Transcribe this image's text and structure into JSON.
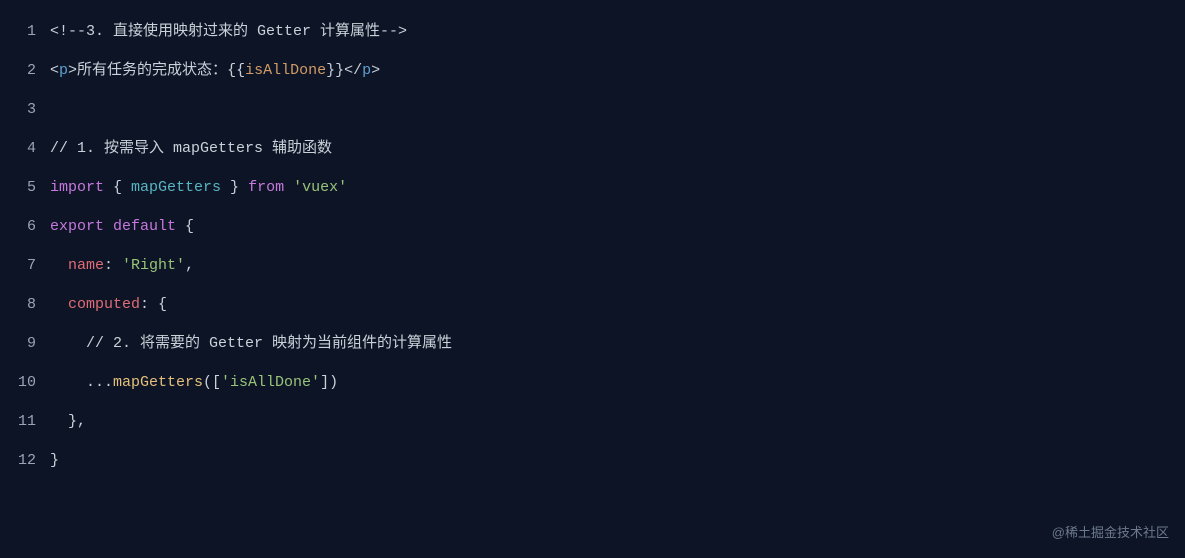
{
  "watermark": "@稀土掘金技术社区",
  "lines": [
    {
      "num": "1",
      "tokens": [
        {
          "cls": "token-comment",
          "text": "<!--3. 直接使用映射过来的 Getter 计算属性-->"
        }
      ]
    },
    {
      "num": "2",
      "tokens": [
        {
          "cls": "token-tag-bracket",
          "text": "<"
        },
        {
          "cls": "token-tag-name",
          "text": "p"
        },
        {
          "cls": "token-tag-bracket",
          "text": ">"
        },
        {
          "cls": "token-text",
          "text": "所有任务的完成状态："
        },
        {
          "cls": "token-text",
          "text": "{{"
        },
        {
          "cls": "token-variable",
          "text": "isAllDone"
        },
        {
          "cls": "token-text",
          "text": "}}"
        },
        {
          "cls": "token-tag-bracket",
          "text": "</"
        },
        {
          "cls": "token-tag-name",
          "text": "p"
        },
        {
          "cls": "token-tag-bracket",
          "text": ">"
        }
      ]
    },
    {
      "num": "3",
      "tokens": []
    },
    {
      "num": "4",
      "tokens": [
        {
          "cls": "token-comment",
          "text": "// 1. 按需导入 mapGetters 辅助函数"
        }
      ]
    },
    {
      "num": "5",
      "tokens": [
        {
          "cls": "token-keyword",
          "text": "import"
        },
        {
          "cls": "token-punctuation",
          "text": " { "
        },
        {
          "cls": "token-identifier",
          "text": "mapGetters"
        },
        {
          "cls": "token-punctuation",
          "text": " } "
        },
        {
          "cls": "token-keyword",
          "text": "from"
        },
        {
          "cls": "token-punctuation",
          "text": " "
        },
        {
          "cls": "token-string",
          "text": "'vuex'"
        }
      ]
    },
    {
      "num": "6",
      "tokens": [
        {
          "cls": "token-keyword",
          "text": "export"
        },
        {
          "cls": "token-punctuation",
          "text": " "
        },
        {
          "cls": "token-keyword",
          "text": "default"
        },
        {
          "cls": "token-punctuation",
          "text": " {"
        }
      ]
    },
    {
      "num": "7",
      "tokens": [
        {
          "cls": "token-punctuation",
          "text": "  "
        },
        {
          "cls": "token-property",
          "text": "name"
        },
        {
          "cls": "token-punctuation",
          "text": ": "
        },
        {
          "cls": "token-string",
          "text": "'Right'"
        },
        {
          "cls": "token-punctuation",
          "text": ","
        }
      ]
    },
    {
      "num": "8",
      "tokens": [
        {
          "cls": "token-punctuation",
          "text": "  "
        },
        {
          "cls": "token-property",
          "text": "computed"
        },
        {
          "cls": "token-punctuation",
          "text": ": {"
        }
      ]
    },
    {
      "num": "9",
      "tokens": [
        {
          "cls": "token-comment",
          "text": "    // 2. 将需要的 Getter 映射为当前组件的计算属性"
        }
      ]
    },
    {
      "num": "10",
      "tokens": [
        {
          "cls": "token-punctuation",
          "text": "    ..."
        },
        {
          "cls": "token-function",
          "text": "mapGetters"
        },
        {
          "cls": "token-punctuation",
          "text": "(["
        },
        {
          "cls": "token-string",
          "text": "'isAllDone'"
        },
        {
          "cls": "token-punctuation",
          "text": "])"
        }
      ]
    },
    {
      "num": "11",
      "tokens": [
        {
          "cls": "token-punctuation",
          "text": "  },"
        }
      ]
    },
    {
      "num": "12",
      "tokens": [
        {
          "cls": "token-punctuation",
          "text": "}"
        }
      ]
    }
  ]
}
